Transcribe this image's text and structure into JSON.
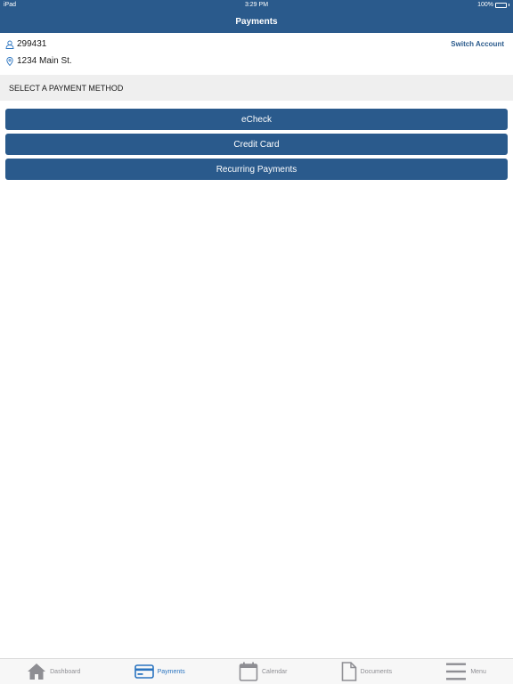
{
  "status_bar": {
    "device": "iPad",
    "time": "3:29 PM",
    "battery": "100%",
    "battery_level": 1.0
  },
  "nav": {
    "title": "Payments"
  },
  "account": {
    "number": "299431",
    "address": "1234 Main St.",
    "switch_label": "Switch Account",
    "user_icon": "user-icon",
    "location_icon": "map-pin-icon"
  },
  "section": {
    "title": "SELECT A PAYMENT METHOD"
  },
  "payment_methods": [
    {
      "label": "eCheck"
    },
    {
      "label": "Credit Card"
    },
    {
      "label": "Recurring Payments"
    }
  ],
  "tab_bar": {
    "tabs": [
      {
        "label": "Dashboard",
        "icon": "home-icon",
        "active": false
      },
      {
        "label": "Payments",
        "icon": "credit-card-icon",
        "active": true
      },
      {
        "label": "Calendar",
        "icon": "calendar-icon",
        "active": false
      },
      {
        "label": "Documents",
        "icon": "document-icon",
        "active": false
      },
      {
        "label": "Menu",
        "icon": "menu-icon",
        "active": false
      }
    ]
  },
  "colors": {
    "brand_blue": "#2a5a8c",
    "active_tab": "#2a74c0",
    "inactive_tab": "#8e8e93",
    "section_bg": "#efefef",
    "battery_green": "#4cd964"
  }
}
